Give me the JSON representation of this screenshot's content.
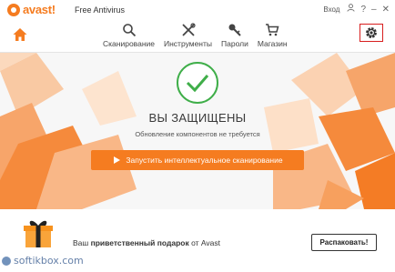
{
  "titlebar": {
    "brand": "avast!",
    "product": "Free Antivirus",
    "login": "Вход",
    "help": "?",
    "minimize": "–",
    "close": "✕"
  },
  "nav": {
    "items": [
      {
        "label": "Сканирование",
        "icon": "search-icon"
      },
      {
        "label": "Инструменты",
        "icon": "tools-icon"
      },
      {
        "label": "Пароли",
        "icon": "key-icon"
      },
      {
        "label": "Магазин",
        "icon": "cart-icon"
      }
    ],
    "settings_icon": "gear-icon",
    "home_icon": "home-icon"
  },
  "status": {
    "title": "ВЫ ЗАЩИЩЕНЫ",
    "subtitle": "Обновление компонентов не требуется",
    "scan_button": "Запустить интеллектуальное сканирование"
  },
  "promo": {
    "text_before": "Ваш ",
    "text_bold": "приветственный подарок",
    "text_after": " от Avast",
    "button": "Распаковать!"
  },
  "watermark": "softikbox.com",
  "colors": {
    "accent": "#f57c20",
    "ok": "#3fae49",
    "highlight": "#d81e1e"
  }
}
